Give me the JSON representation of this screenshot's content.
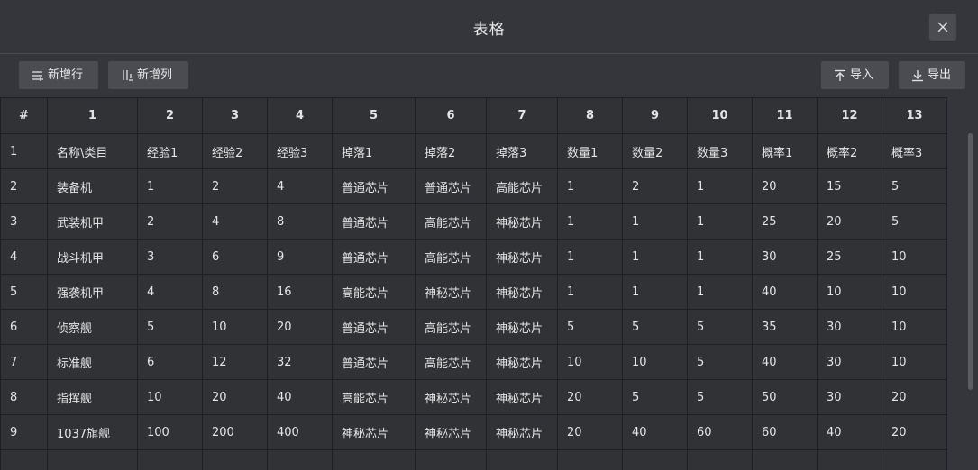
{
  "dialog": {
    "title": "表格",
    "close_icon": "close-icon"
  },
  "toolbar": {
    "add_row_label": "新增行",
    "add_col_label": "新增列",
    "import_label": "导入",
    "export_label": "导出"
  },
  "table": {
    "headers": [
      "#",
      "1",
      "2",
      "3",
      "4",
      "5",
      "6",
      "7",
      "8",
      "9",
      "10",
      "11",
      "12",
      "13"
    ],
    "rows": [
      [
        "1",
        "名称\\类目",
        "经验1",
        "经验2",
        "经验3",
        "掉落1",
        "掉落2",
        "掉落3",
        "数量1",
        "数量2",
        "数量3",
        "概率1",
        "概率2",
        "概率3"
      ],
      [
        "2",
        "装备机",
        "1",
        "2",
        "4",
        "普通芯片",
        "普通芯片",
        "高能芯片",
        "1",
        "2",
        "1",
        "20",
        "15",
        "5"
      ],
      [
        "3",
        "武装机甲",
        "2",
        "4",
        "8",
        "普通芯片",
        "高能芯片",
        "神秘芯片",
        "1",
        "1",
        "1",
        "25",
        "20",
        "5"
      ],
      [
        "4",
        "战斗机甲",
        "3",
        "6",
        "9",
        "普通芯片",
        "高能芯片",
        "神秘芯片",
        "1",
        "1",
        "1",
        "30",
        "25",
        "10"
      ],
      [
        "5",
        "强袭机甲",
        "4",
        "8",
        "16",
        "高能芯片",
        "神秘芯片",
        "神秘芯片",
        "1",
        "1",
        "1",
        "40",
        "10",
        "10"
      ],
      [
        "6",
        "侦察舰",
        "5",
        "10",
        "20",
        "普通芯片",
        "高能芯片",
        "神秘芯片",
        "5",
        "5",
        "5",
        "35",
        "30",
        "10"
      ],
      [
        "7",
        "标准舰",
        "6",
        "12",
        "32",
        "普通芯片",
        "高能芯片",
        "神秘芯片",
        "10",
        "10",
        "5",
        "40",
        "30",
        "10"
      ],
      [
        "8",
        "指挥舰",
        "10",
        "20",
        "40",
        "高能芯片",
        "神秘芯片",
        "神秘芯片",
        "20",
        "5",
        "5",
        "50",
        "30",
        "20"
      ],
      [
        "9",
        "1037旗舰",
        "100",
        "200",
        "400",
        "神秘芯片",
        "神秘芯片",
        "神秘芯片",
        "20",
        "40",
        "60",
        "60",
        "40",
        "20"
      ],
      [
        "",
        "",
        "",
        "",
        "",
        "",
        "",
        "",
        "",
        "",
        "",
        "",
        "",
        ""
      ]
    ]
  }
}
